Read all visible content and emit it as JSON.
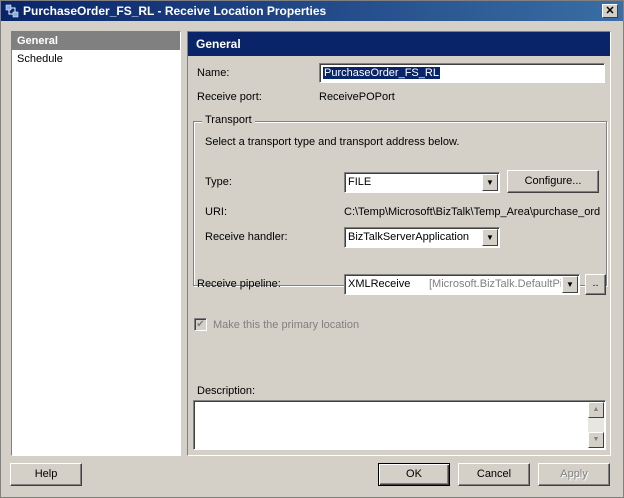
{
  "window": {
    "title": "PurchaseOrder_FS_RL - Receive Location Properties",
    "close_label": "✕"
  },
  "nav": {
    "items": [
      {
        "label": "General",
        "selected": true
      },
      {
        "label": "Schedule",
        "selected": false
      }
    ]
  },
  "general": {
    "header": "General",
    "name_label": "Name:",
    "name_value": "PurchaseOrder_FS_RL",
    "receive_port_label": "Receive port:",
    "receive_port_value": "ReceivePOPort",
    "transport": {
      "group_title": "Transport",
      "instructions": "Select a transport type and transport address below.",
      "type_label": "Type:",
      "type_value": "FILE",
      "configure_label": "Configure...",
      "uri_label": "URI:",
      "uri_value": "C:\\Temp\\Microsoft\\BizTalk\\Temp_Area\\purchase_ord",
      "handler_label": "Receive handler:",
      "handler_value": "BizTalkServerApplication"
    },
    "pipeline_label": "Receive pipeline:",
    "pipeline_value": "XMLReceive",
    "pipeline_assembly": "[Microsoft.BizTalk.DefaultPip",
    "pipeline_button": "..",
    "primary_label": "Make this the primary location",
    "primary_checked": true,
    "description_label": "Description:",
    "description_value": ""
  },
  "footer": {
    "help_label": "Help",
    "ok_label": "OK",
    "cancel_label": "Cancel",
    "apply_label": "Apply"
  }
}
